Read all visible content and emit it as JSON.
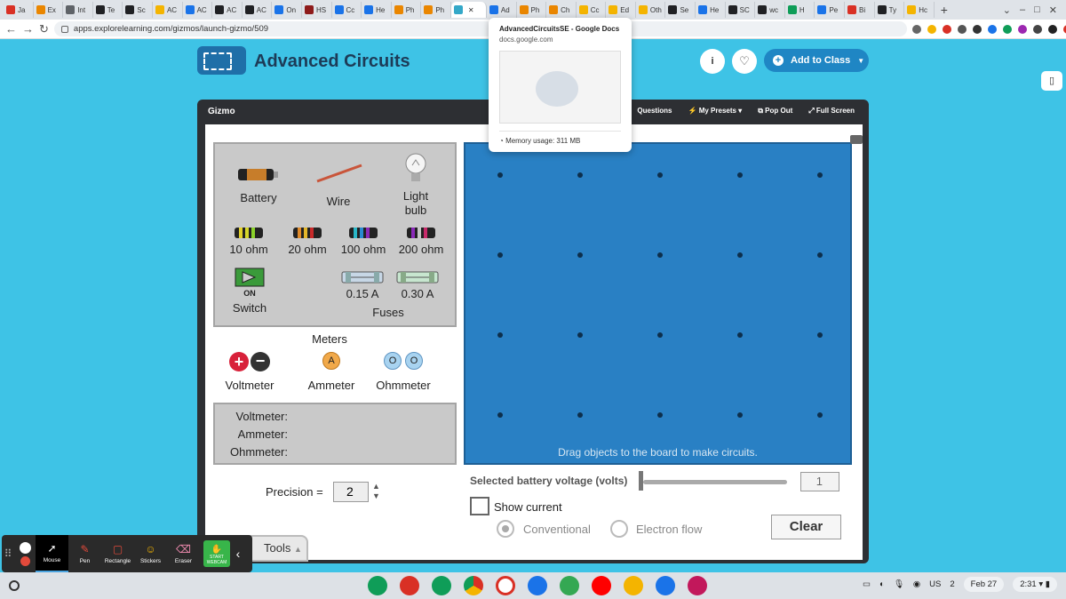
{
  "browser": {
    "tabs": [
      {
        "label": "Ja",
        "color": "#d93025"
      },
      {
        "label": "Ex",
        "color": "#ea8600"
      },
      {
        "label": "Int",
        "color": "#5f6368"
      },
      {
        "label": "Te",
        "color": "#202124"
      },
      {
        "label": "Sc",
        "color": "#202124"
      },
      {
        "label": "AC",
        "color": "#f4b400"
      },
      {
        "label": "AC",
        "color": "#1a73e8"
      },
      {
        "label": "AC",
        "color": "#202124"
      },
      {
        "label": "AC",
        "color": "#202124"
      },
      {
        "label": "On",
        "color": "#1a73e8"
      },
      {
        "label": "HS",
        "color": "#8e1b1b"
      },
      {
        "label": "Cc",
        "color": "#1a73e8"
      },
      {
        "label": "He",
        "color": "#1a73e8"
      },
      {
        "label": "Ph",
        "color": "#ea8600"
      },
      {
        "label": "Ph",
        "color": "#ea8600"
      },
      {
        "label": "",
        "color": "#34a8c8",
        "active": true
      },
      {
        "label": "Ad",
        "color": "#1a73e8"
      },
      {
        "label": "Ph",
        "color": "#ea8600"
      },
      {
        "label": "Ch",
        "color": "#ea8600"
      },
      {
        "label": "Cc",
        "color": "#f4b400"
      },
      {
        "label": "Ed",
        "color": "#f4b400"
      },
      {
        "label": "Oth",
        "color": "#f4b400"
      },
      {
        "label": "Se",
        "color": "#202124"
      },
      {
        "label": "He",
        "color": "#1a73e8"
      },
      {
        "label": "SC",
        "color": "#202124"
      },
      {
        "label": "wc",
        "color": "#202124"
      },
      {
        "label": "H",
        "color": "#0f9d58"
      },
      {
        "label": "Pe",
        "color": "#1a73e8"
      },
      {
        "label": "Bi",
        "color": "#d93025"
      },
      {
        "label": "Ty",
        "color": "#202124"
      },
      {
        "label": "Hc",
        "color": "#f4b400"
      }
    ],
    "new_tab": "+",
    "url": "apps.explorelearning.com/gizmos/launch-gizmo/509"
  },
  "header": {
    "title": "Advanced Circuits",
    "info_icon": "i",
    "heart_icon": "♡",
    "add_to_class": "Add to Class"
  },
  "gizmo": {
    "label": "Gizmo",
    "actions": [
      "Questions",
      "My Presets",
      "Pop Out",
      "Full Screen"
    ],
    "palette": {
      "battery": "Battery",
      "wire": "Wire",
      "light_bulb": "Light bulb",
      "resistors": [
        "10 ohm",
        "20 ohm",
        "100 ohm",
        "200 ohm"
      ],
      "switch_state": "ON",
      "switch": "Switch",
      "fuses": [
        "0.15 A",
        "0.30 A"
      ],
      "fuses_label": "Fuses"
    },
    "meters": {
      "title": "Meters",
      "voltmeter": "Voltmeter",
      "ammeter": "Ammeter",
      "ohmmeter": "Ohmmeter",
      "ammeter_symbol": "A",
      "ohmmeter_symbol": "O"
    },
    "readouts": [
      "Voltmeter:",
      "Ammeter:",
      "Ohmmeter:"
    ],
    "precision_label": "Precision =",
    "precision_value": "2",
    "board_hint": "Drag objects to the board to make circuits.",
    "voltage_label": "Selected battery voltage (volts)",
    "voltage_value": "1",
    "voltage_slider_level": 0,
    "show_current": "Show current",
    "conventional": "Conventional",
    "electron_flow": "Electron flow",
    "clear": "Clear",
    "tools": "Tools"
  },
  "preview": {
    "title": "AdvancedCircuitsSE - Google Docs",
    "domain": "docs.google.com",
    "memory": "Memory usage: 311 MB"
  },
  "annotate": {
    "tools": [
      "Mouse",
      "Pen",
      "Rectangle",
      "Stickers",
      "Eraser"
    ],
    "webcam": "START WEBCAM"
  },
  "shelf": {
    "keyboard": "US",
    "notifications": "2",
    "date": "Feb 27",
    "time": "2:31"
  }
}
